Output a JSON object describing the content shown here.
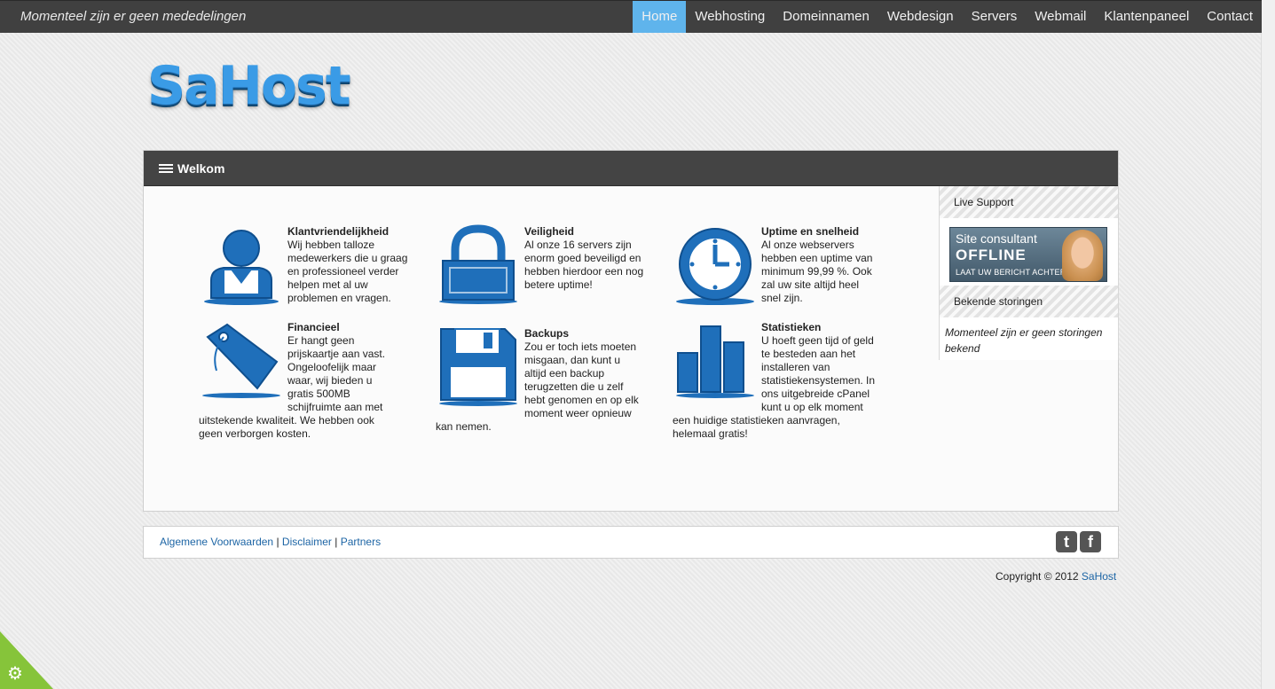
{
  "topbar": {
    "announcement": "Momenteel zijn er geen mededelingen",
    "nav": [
      {
        "label": "Home",
        "active": true
      },
      {
        "label": "Webhosting"
      },
      {
        "label": "Domeinnamen"
      },
      {
        "label": "Webdesign"
      },
      {
        "label": "Servers"
      },
      {
        "label": "Webmail"
      },
      {
        "label": "Klantenpaneel"
      },
      {
        "label": "Contact"
      }
    ]
  },
  "logo": {
    "text": "SaHost"
  },
  "panel": {
    "title": "Welkom"
  },
  "features": [
    {
      "title": "Klantvriendelijkheid",
      "text": "Wij hebben talloze medewerkers die u graag en professioneel verder helpen met al uw problemen en vragen.",
      "icon": "user-icon"
    },
    {
      "title": "Veiligheid",
      "text": "Al onze 16 servers zijn enorm goed beveiligd en hebben hierdoor een nog betere uptime!",
      "icon": "lock-icon"
    },
    {
      "title": "Uptime en snelheid",
      "text": "Al onze webservers hebben een uptime van minimum 99,99 %. Ook zal uw site altijd heel snel zijn.",
      "icon": "clock-icon"
    },
    {
      "title": "Financieel",
      "text": "Er hangt geen prijskaartje aan vast. Ongeloofelijk maar waar, wij bieden u gratis 500MB schijfruimte aan met uitstekende kwaliteit. We hebben ook geen verborgen kosten.",
      "icon": "price-tag-icon"
    },
    {
      "title": "Backups",
      "text": "Zou er toch iets moeten misgaan, dan kunt u altijd een backup terugzetten die u zelf hebt genomen en op elk moment weer opnieuw kan nemen.",
      "icon": "floppy-disk-icon"
    },
    {
      "title": "Statistieken",
      "text": "U hoeft geen tijd of geld te besteden aan het installeren van statistiekensystemen. In ons uitgebreide cPanel kunt u op elk moment een huidige statistieken aanvragen, helemaal gratis!",
      "icon": "bar-chart-icon"
    }
  ],
  "sidebar": {
    "live_support_title": "Live Support",
    "banner_line1": "Site consultant",
    "banner_line2": "OFFLINE",
    "banner_line3": "LAAT UW BERICHT ACHTER",
    "storingen_title": "Bekende storingen",
    "storingen_text": "Momenteel zijn er geen storingen bekend"
  },
  "footer": {
    "links": [
      "Algemene Voorwaarden",
      "Disclaimer",
      "Partners"
    ],
    "separator": "|",
    "twitter_glyph": "t",
    "facebook_glyph": "f"
  },
  "copyright": {
    "text": "Copyright © 2012",
    "brand": "SaHost"
  },
  "colors": {
    "accent": "#5fb4ec",
    "topbar": "#404040",
    "icon_blue": "#1f6fba",
    "link": "#1d65a5",
    "cookie": "#86c43a"
  }
}
